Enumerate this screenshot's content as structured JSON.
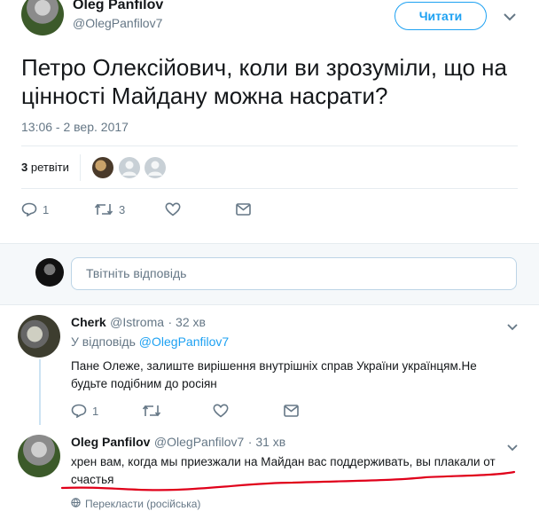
{
  "tweet": {
    "author_name": "Oleg Panfilov",
    "author_handle": "@OlegPanfilov7",
    "follow_label": "Читати",
    "text": "Петро Олексійович, коли ви зрозуміли, що на цінності Майдану можна насрати?",
    "timestamp": "13:06 - 2 вер. 2017",
    "retweet_count": "3",
    "retweet_label": "ретвіти",
    "reply_count": "1",
    "retweets_action_count": "3"
  },
  "reply_box": {
    "placeholder": "Твітніть відповідь"
  },
  "replies": [
    {
      "name": "Cherk",
      "handle": "@Istroma",
      "time": "· 32 хв",
      "in_reply_prefix": "У відповідь",
      "in_reply_to": "@OlegPanfilov7",
      "text": "Пане Олеже, залиште вирішення внутрішніх справ України українцям.Не будьте подібним до росіян",
      "reply_count": "1"
    },
    {
      "name": "Oleg Panfilov",
      "handle": "@OlegPanfilov7",
      "time": "· 31 хв",
      "text": "хрен вам, когда мы приезжали на Майдан вас поддерживать, вы плакали от счастья",
      "translate_label": "Перекласти (російська)"
    }
  ],
  "icons": {
    "accent": "#1da1f2",
    "muted": "#657786",
    "annotation": "#e0001a"
  }
}
